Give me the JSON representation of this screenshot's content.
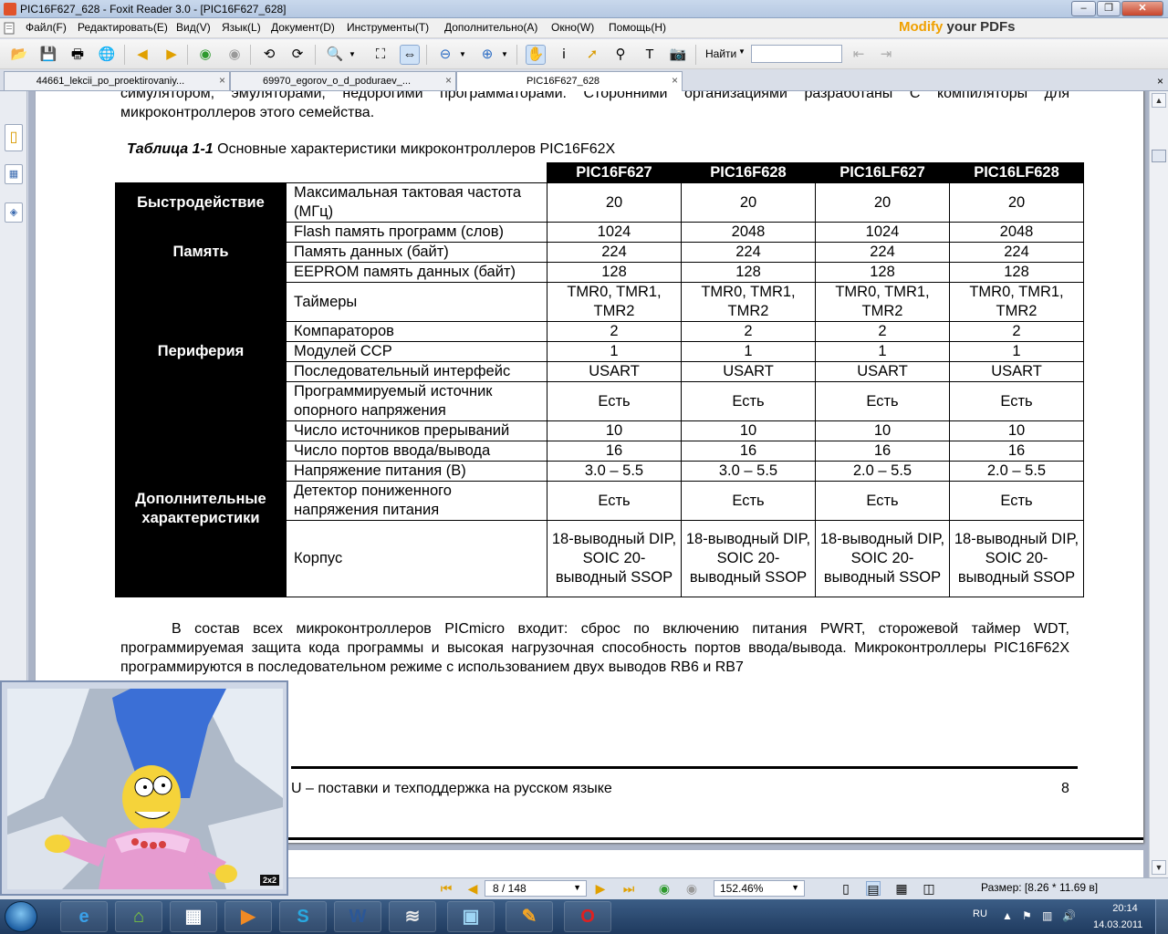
{
  "window": {
    "title": "PIC16F627_628 - Foxit Reader 3.0 - [PIC16F627_628]"
  },
  "menu": {
    "items": [
      "Файл(F)",
      "Редактировать(E)",
      "Вид(V)",
      "Язык(L)",
      "Документ(D)",
      "Инструменты(T)",
      "Дополнительно(A)",
      "Окно(W)",
      "Помощь(H)"
    ],
    "ad_word1": "Modify",
    "ad_word2": " your PDFs"
  },
  "toolbar": {
    "find_label": "Найти",
    "find_value": ""
  },
  "tabs": [
    {
      "label": "44661_lekcii_po_proektirovaniy...",
      "active": false
    },
    {
      "label": "69970_egorov_o_d_poduraev_...",
      "active": false
    },
    {
      "label": "PIC16F627_628",
      "active": true
    }
  ],
  "document": {
    "intro_text": "симулятором, эмуляторами, недорогими программаторами. Сторонними организациями разработаны С компиляторы для микроконтроллеров этого семейства.",
    "caption_bold": "Таблица 1-1",
    "caption_rest": " Основные характеристики микроконтроллеров PIC16F62X",
    "table": {
      "columns": [
        "PIC16F627",
        "PIC16F628",
        "PIC16LF627",
        "PIC16LF628"
      ],
      "groups": [
        {
          "name": "Быстродействие",
          "rows": [
            {
              "param": "Максимальная тактовая частота (МГц)",
              "values": [
                "20",
                "20",
                "20",
                "20"
              ]
            }
          ]
        },
        {
          "name": "Память",
          "rows": [
            {
              "param": "Flash память программ (слов)",
              "values": [
                "1024",
                "2048",
                "1024",
                "2048"
              ]
            },
            {
              "param": "Память данных (байт)",
              "values": [
                "224",
                "224",
                "224",
                "224"
              ]
            },
            {
              "param": "EEPROM память данных (байт)",
              "values": [
                "128",
                "128",
                "128",
                "128"
              ]
            }
          ]
        },
        {
          "name": "Периферия",
          "rows": [
            {
              "param": "Таймеры",
              "values": [
                "TMR0, TMR1, TMR2",
                "TMR0, TMR1, TMR2",
                "TMR0, TMR1, TMR2",
                "TMR0, TMR1, TMR2"
              ]
            },
            {
              "param": "Компараторов",
              "values": [
                "2",
                "2",
                "2",
                "2"
              ]
            },
            {
              "param": "Модулей CCP",
              "values": [
                "1",
                "1",
                "1",
                "1"
              ]
            },
            {
              "param": "Последовательный интерфейс",
              "values": [
                "USART",
                "USART",
                "USART",
                "USART"
              ]
            },
            {
              "param": "Программируемый источник опорного напряжения",
              "values": [
                "Есть",
                "Есть",
                "Есть",
                "Есть"
              ]
            }
          ]
        },
        {
          "name": "Дополнительные характеристики",
          "rows": [
            {
              "param": "Число источников прерываний",
              "values": [
                "10",
                "10",
                "10",
                "10"
              ]
            },
            {
              "param": "Число портов ввода/вывода",
              "values": [
                "16",
                "16",
                "16",
                "16"
              ]
            },
            {
              "param": "Напряжение питания (В)",
              "values": [
                "3.0 – 5.5",
                "3.0 – 5.5",
                "2.0 – 5.5",
                "2.0 – 5.5"
              ]
            },
            {
              "param": "Детектор пониженного напряжения питания",
              "values": [
                "Есть",
                "Есть",
                "Есть",
                "Есть"
              ]
            },
            {
              "param": "Корпус",
              "values": [
                "18-выводный DIP, SOIC 20-выводный SSOP",
                "18-выводный DIP, SOIC 20-выводный SSOP",
                "18-выводный DIP, SOIC 20-выводный SSOP",
                "18-выводный DIP, SOIC 20-выводный SSOP"
              ]
            }
          ]
        }
      ]
    },
    "paragraph_line1": "В состав всех микроконтроллеров PICmicro входит: сброс по включению питания PWRT, сторожевой таймер",
    "paragraph_rest": "WDT, программируемая защита кода программы и высокая нагрузочная способность портов ввода/вывода. Микроконтроллеры PIC16F62X программируются в последовательном режиме с использованием двух выводов RB6 и",
    "paragraph_cut": "RB7",
    "footer_text": "U – поставки и техподдержка на русском языке",
    "footer_page": "8"
  },
  "statusbar": {
    "page_value": "8 / 148",
    "zoom_value": "152.46%",
    "size_text": "Размер: [8.26 * 11.69 в]"
  },
  "video": {
    "channel_logo": "2x2"
  },
  "taskbar": {
    "word_label": "W",
    "lang": "RU",
    "time": "20:14",
    "date": "14.03.2011"
  }
}
